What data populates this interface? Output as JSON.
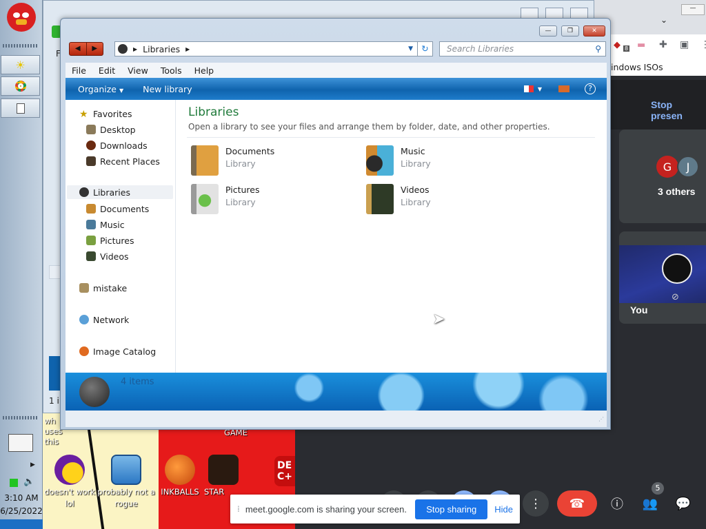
{
  "explorer": {
    "breadcrumb": "Libraries",
    "search_placeholder": "Search Libraries",
    "menu": [
      "File",
      "Edit",
      "View",
      "Tools",
      "Help"
    ],
    "toolbar": {
      "organize": "Organize",
      "new_library": "New library"
    },
    "nav": {
      "favorites": "Favorites",
      "desktop": "Desktop",
      "downloads": "Downloads",
      "recent": "Recent Places",
      "libraries": "Libraries",
      "documents": "Documents",
      "music": "Music",
      "pictures": "Pictures",
      "videos": "Videos",
      "mistake": "mistake",
      "network": "Network",
      "image_catalog": "Image Catalog"
    },
    "content": {
      "title": "Libraries",
      "subtitle": "Open a library to see your files and arrange them by folder, date, and other properties.",
      "items": [
        {
          "name": "Documents",
          "type": "Library"
        },
        {
          "name": "Music",
          "type": "Library"
        },
        {
          "name": "Pictures",
          "type": "Library"
        },
        {
          "name": "Videos",
          "type": "Library"
        }
      ]
    },
    "details": {
      "count": "4 items"
    }
  },
  "background_window": {
    "status_text": "1 i",
    "menu_fragment": "F"
  },
  "browser": {
    "bookmark_fragment": "indows ISOs",
    "stop_presenting": "Stop presen",
    "others_label": "3 others",
    "avatar_g": "G",
    "avatar_j": "J",
    "you_label": "You",
    "extension_badge": "8"
  },
  "meet": {
    "share_message": "meet.google.com is sharing your screen.",
    "stop_sharing": "Stop sharing",
    "hide": "Hide",
    "people_badge": "5"
  },
  "taskbar": {
    "time": "3:10 AM",
    "date": "6/25/2022"
  },
  "desktop_icons": [
    {
      "label": "uses this",
      "top_fragment": "wh"
    },
    {
      "label": "doesn't work lol"
    },
    {
      "label": "probably not a rogue"
    },
    {
      "label": "INKBALLS"
    },
    {
      "label": "STAR"
    },
    {
      "label": "GAME"
    }
  ],
  "colors": {
    "accent": "#1a73e8",
    "end_call": "#ea4335",
    "explorer_bar": "#0f63ad",
    "title_green": "#1f7a3a"
  }
}
